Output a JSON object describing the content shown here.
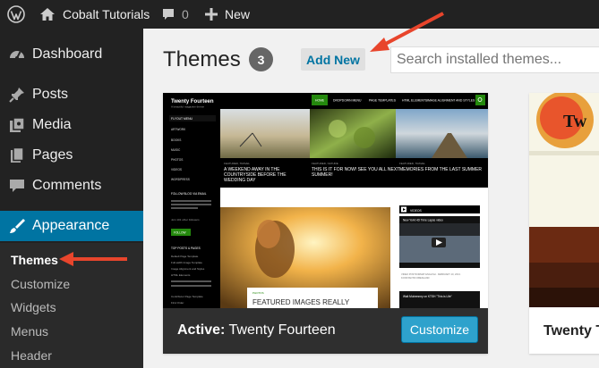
{
  "adminbar": {
    "site_name": "Cobalt Tutorials",
    "comments_count": "0",
    "new_label": "New"
  },
  "sidebar": {
    "items": [
      {
        "label": "Dashboard",
        "icon": "dashboard-icon"
      },
      {
        "label": "Posts",
        "icon": "pin-icon"
      },
      {
        "label": "Media",
        "icon": "media-icon"
      },
      {
        "label": "Pages",
        "icon": "pages-icon"
      },
      {
        "label": "Comments",
        "icon": "comment-bubble-icon"
      },
      {
        "label": "Appearance",
        "icon": "paintbrush-icon"
      }
    ],
    "submenu": [
      "Themes",
      "Customize",
      "Widgets",
      "Menus",
      "Header"
    ]
  },
  "main": {
    "title": "Themes",
    "count": "3",
    "add_new_label": "Add New",
    "search_placeholder": "Search installed themes..."
  },
  "active_theme": {
    "active_prefix": "Active:",
    "name": "Twenty Fourteen",
    "customize_label": "Customize",
    "preview": {
      "site_title": "Twenty Fourteen",
      "tagline": "A beautiful magazine theme",
      "nav": [
        "HOME",
        "DROPDOWN MENU",
        "PAGE TEMPLATES",
        "HTML ELEMENTS",
        "IMAGE ALIGNMENT AND STYLES"
      ],
      "side_menu": [
        "FLYOUT MENU",
        "ARTWORK",
        "BOOKS",
        "MUSIC",
        "PHOTOS",
        "VIDEOS",
        "WORDPRESS"
      ],
      "follow_heading": "FOLLOW BLOG VIA EMAIL",
      "follow_text": "Click to follow this blog and receive notifications of new posts by email.",
      "followers": "Join 101 other followers",
      "follow_button": "FOLLOW",
      "top_heading": "TOP POSTS & PAGES",
      "top_links": [
        "Default Page Template",
        "Full-width Image Template",
        "Image Alignment and Styles",
        "HTML Elements",
        "A weekend away in the countryside before the wedding day",
        "Contributor Page Template",
        "First Order"
      ],
      "posts": [
        {
          "cat": "FEATURED, TRAVEL",
          "title": "A WEEKEND AWAY IN THE COUNTRYSIDE BEFORE THE WEDDING DAY"
        },
        {
          "cat": "FEATURED, NATURE",
          "title": "THIS IS IT FOR NOW! SEE YOU ALL NEXT SUMMER!"
        },
        {
          "cat": "FEATURED, TRAVEL",
          "title": "MEMORIES FROM THE LAST SUMMER"
        }
      ],
      "featured_cat": "PHOTOS",
      "featured_title": "FEATURED IMAGES REALLY",
      "videos_heading": "VIDEOS",
      "video_title": "New York HD Time Lapse video",
      "video_caption": "VIDEO POSTFORMAT ENGLISH · FEBRUARY 10, 2013 · KONSTANTIN OBENLAND",
      "video2_title": "Walt Mulvenney on KTSH \"This is Life\""
    }
  },
  "second_theme": {
    "name": "Twenty T",
    "preview_title": "Tw"
  },
  "colors": {
    "adminbar": "#222222",
    "sidebar": "#222222",
    "active_menu": "#0074a2",
    "primary_button": "#2ea2cc",
    "annotation_arrow": "#e8452c"
  }
}
